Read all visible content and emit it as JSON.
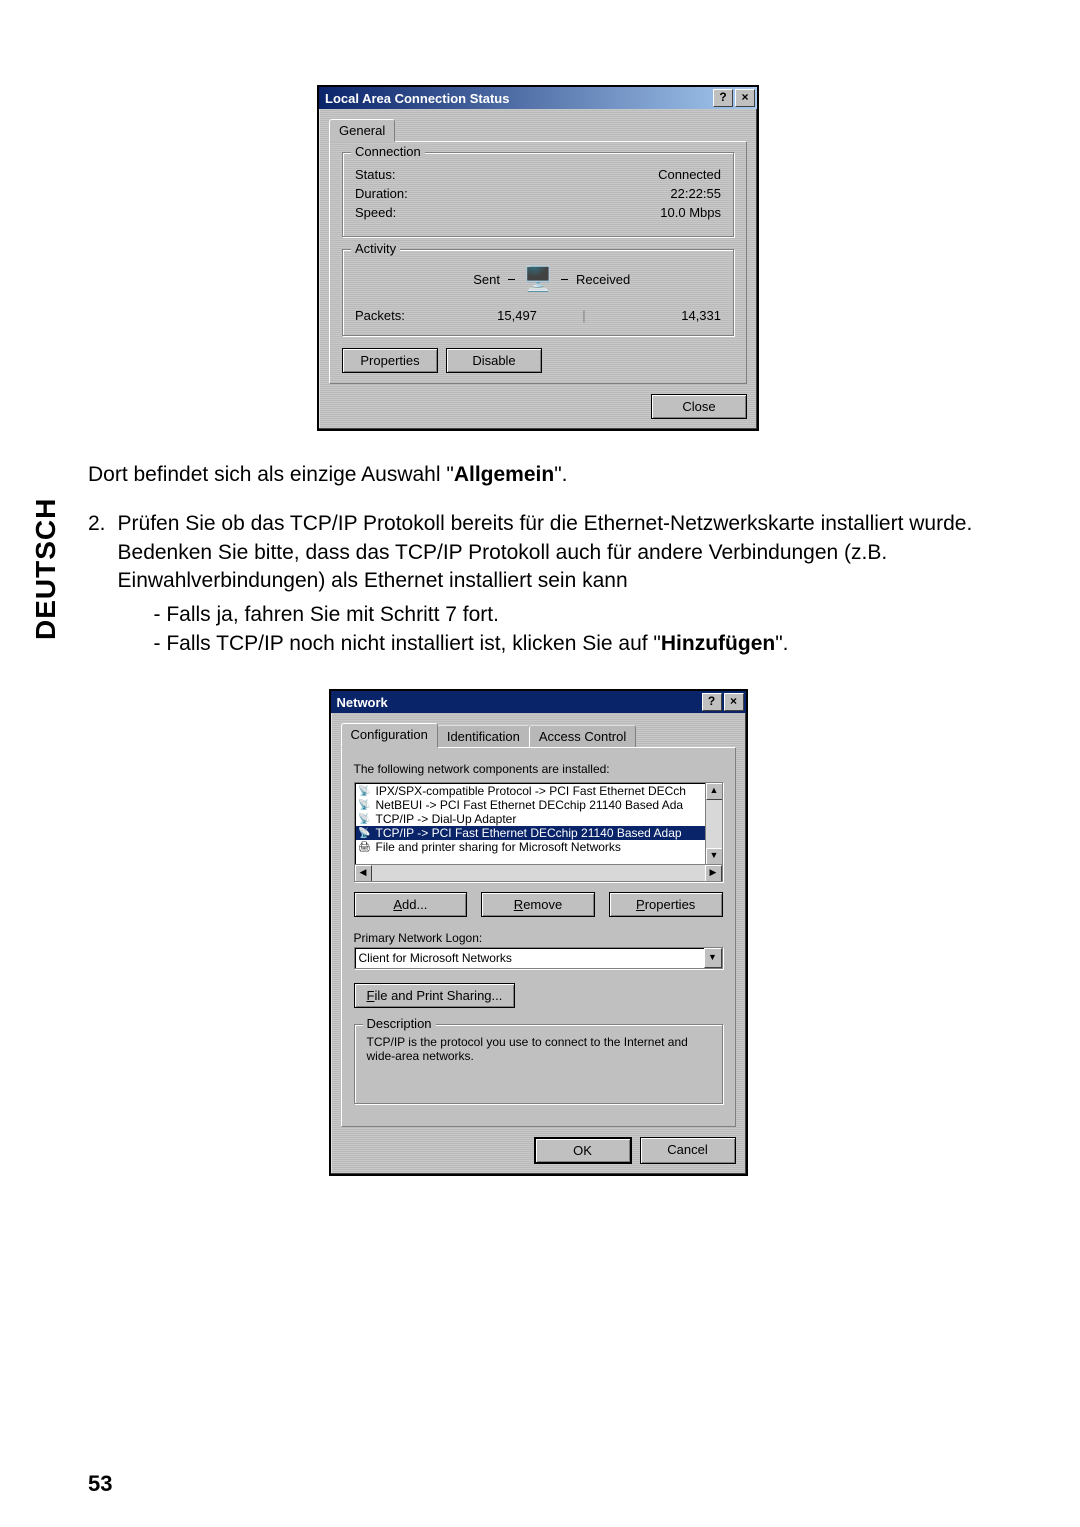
{
  "sideLabel": "DEUTSCH",
  "pageNumber": "53",
  "dialog1": {
    "title": "Local Area Connection Status",
    "tab": "General",
    "group_connection": "Connection",
    "status_label": "Status:",
    "status_value": "Connected",
    "duration_label": "Duration:",
    "duration_value": "22:22:55",
    "speed_label": "Speed:",
    "speed_value": "10.0 Mbps",
    "group_activity": "Activity",
    "sent_label": "Sent",
    "received_label": "Received",
    "packets_label": "Packets:",
    "packets_sent": "15,497",
    "packets_received": "14,331",
    "btn_properties": "Properties",
    "btn_disable": "Disable",
    "btn_close": "Close"
  },
  "paragraph1_pre": "Dort befindet sich als einzige Auswahl \"",
  "paragraph1_bold": "Allgemein",
  "paragraph1_post": "\".",
  "item2_num": "2.",
  "item2_text": "Prüfen Sie ob das TCP/IP Protokoll bereits für die Ethernet-Netzwerkskarte installiert wurde. Bedenken Sie bitte, dass das TCP/IP Protokoll auch für andere Verbindungen (z.B. Einwahlverbindungen) als Ethernet installiert sein kann",
  "bullet1": "Falls ja, fahren Sie mit Schritt 7 fort.",
  "bullet2_pre": "Falls TCP/IP noch nicht installiert ist, klicken Sie auf \"",
  "bullet2_bold": "Hinzufügen",
  "bullet2_post": "\".",
  "dialog2": {
    "title": "Network",
    "tab1": "Configuration",
    "tab2": "Identification",
    "tab3": "Access Control",
    "lbl_components": "The following network components are installed:",
    "items": {
      "i0": "IPX/SPX-compatible Protocol -> PCI Fast Ethernet DECch",
      "i1": "NetBEUI -> PCI Fast Ethernet DECchip 21140 Based Ada",
      "i2": "TCP/IP -> Dial-Up Adapter",
      "i3": "TCP/IP -> PCI Fast Ethernet DECchip 21140 Based Adap",
      "i4": "File and printer sharing for Microsoft Networks"
    },
    "btn_add": "Add...",
    "btn_remove": "Remove",
    "btn_properties": "Properties",
    "lbl_primary": "Primary Network Logon:",
    "dropdown_value": "Client for Microsoft Networks",
    "btn_fileprint": "File and Print Sharing...",
    "group_desc": "Description",
    "desc_text": "TCP/IP is the protocol you use to connect to the Internet and wide-area networks.",
    "btn_ok": "OK",
    "btn_cancel": "Cancel"
  }
}
